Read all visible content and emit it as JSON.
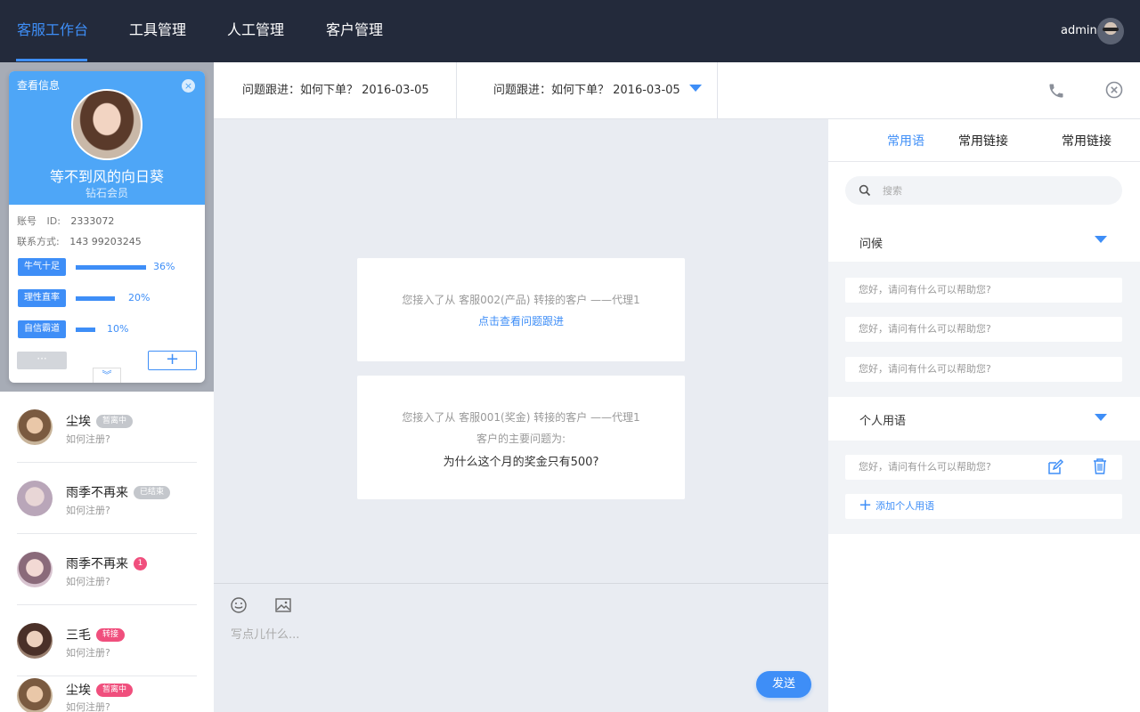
{
  "nav": {
    "items": [
      "客服工作台",
      "工具管理",
      "人工管理",
      "客户管理"
    ],
    "admin_name": "admin"
  },
  "customer_card": {
    "title": "查看信息",
    "close_icon": "×",
    "name": "等不到风的向日葵",
    "level": "钻石会员",
    "account_label": "账号",
    "id_label": "ID:",
    "id_value": "2333072",
    "contact_label": "联系方式:",
    "contact_value": "143 99203245",
    "tags": [
      {
        "label": "牛气十足",
        "pct": "36%",
        "value": 36
      },
      {
        "label": "理性直率",
        "pct": "20%",
        "value": 20
      },
      {
        "label": "自信霸道",
        "pct": "10%",
        "value": 10
      }
    ],
    "more_label": "···",
    "add_label": "+",
    "expand_icon": "︾"
  },
  "conversations": [
    {
      "name": "尘埃",
      "sub": "如何注册?",
      "badge": "暂离中",
      "badge_style": "grey"
    },
    {
      "name": "雨季不再来",
      "sub": "如何注册?",
      "badge": "已结束",
      "badge_style": "grey"
    },
    {
      "name": "雨季不再来",
      "sub": "如何注册?",
      "badge": "1",
      "badge_style": "count"
    },
    {
      "name": "三毛",
      "sub": "如何注册?",
      "badge": "转接",
      "badge_style": "pink"
    },
    {
      "name": "尘埃",
      "sub": "如何注册?",
      "badge": "暂离中",
      "badge_style": "pink"
    }
  ],
  "subtabs": [
    {
      "label": "问题跟进：如何下单？ 2016-03-05"
    },
    {
      "label": "问题跟进：如何下单？ 2016-03-05"
    }
  ],
  "messages": {
    "m1_line1": "您接入了从  客服002(产品)  转接的客户  ——代理1",
    "m1_link": "点击查看问题跟进",
    "m2_line1": "您接入了从  客服001(奖金)  转接的客户  ——代理1",
    "m2_line2": "客户的主要问题为:",
    "m2_line3": "为什么这个月的奖金只有500?"
  },
  "composer": {
    "placeholder": "写点儿什么...",
    "send_label": "发送"
  },
  "right_panel": {
    "tabs": [
      "常用语",
      "常用链接",
      "常用链接"
    ],
    "search_placeholder": "搜索",
    "greeting_title": "问候",
    "greeting_phrases": [
      "您好，请问有什么可以帮助您?",
      "您好，请问有什么可以帮助您?",
      "您好，请问有什么可以帮助您?"
    ],
    "personal_title": "个人用语",
    "personal_phrases": [
      "您好，请问有什么可以帮助您?"
    ],
    "add_phrase_label": "添加个人用语"
  },
  "colors": {
    "accent": "#3e8ef7",
    "topbar": "#232a3b",
    "card_header": "#4ea6f7",
    "badge_pink": "#f04f7d",
    "badge_grey": "#c4c7cc"
  }
}
